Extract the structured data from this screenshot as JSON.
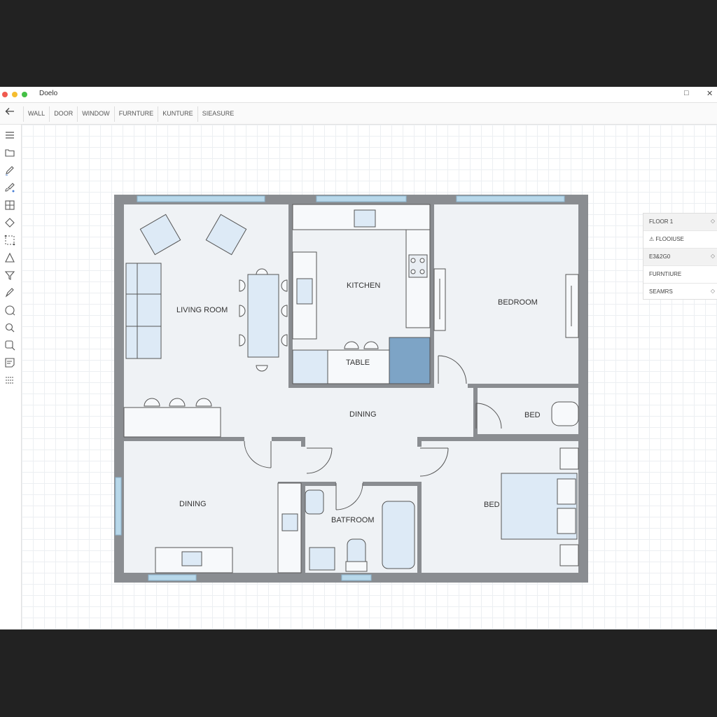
{
  "window": {
    "title": "Doelo",
    "controls": [
      "□",
      "✕"
    ]
  },
  "toolbar": {
    "back_icon": "arrow-left-icon",
    "tabs": [
      {
        "label": "WALL"
      },
      {
        "label": "DOOR"
      },
      {
        "label": "WINDOW"
      },
      {
        "label": "FURNTURE"
      },
      {
        "label": "KUNTURE"
      },
      {
        "label": "SIEASURE"
      }
    ]
  },
  "sidebar": {
    "tools": [
      "menu-icon",
      "folder-icon",
      "pencil-icon",
      "brush-icon",
      "grid-icon",
      "diamond-icon",
      "selection-icon",
      "triangle-icon",
      "filter-icon",
      "pen-icon",
      "circle-icon",
      "search-icon",
      "zoom-icon",
      "note-icon",
      "list-icon"
    ]
  },
  "layers_panel": {
    "items": [
      {
        "label": "FLOOR 1",
        "chevron": "◇"
      },
      {
        "label": "FLOOIUSE",
        "prefix": "⚠"
      },
      {
        "label": "E3&2G0",
        "chevron": "◇"
      },
      {
        "label": "FURNTIURE"
      },
      {
        "label": "SEAMRS",
        "chevron": "◇"
      }
    ]
  },
  "floor_plan": {
    "rooms": {
      "living_room": "LIVING ROOM",
      "kitchen": "KITCHEN",
      "table": "TABLE",
      "bedroom": "BEDROOM",
      "dining_center": "DINING",
      "bed_small": "BED",
      "dining_lower": "DINING",
      "bathroom": "BATFROOM",
      "bed_lower": "BED"
    }
  },
  "colors": {
    "wall": "#8a8d91",
    "floor": "#eff2f5",
    "furniture_fill": "#ddeaf6",
    "accent_blue": "#7da4c6",
    "window": "#b8d8ea",
    "grid": "#eceff2"
  }
}
